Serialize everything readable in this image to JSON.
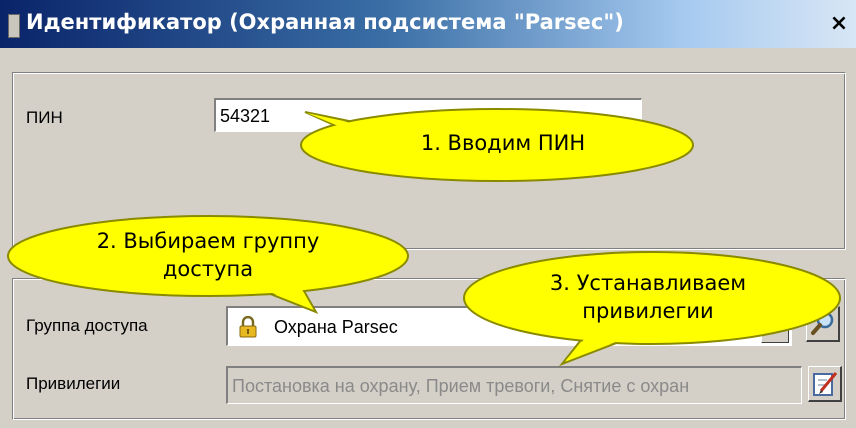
{
  "window": {
    "title": "Идентификатор (Охранная подсистема \"Parsec\")",
    "close_label": "×"
  },
  "fields": {
    "pin_label": "ПИН",
    "pin_value": "54321",
    "access_group_label": "Группа доступа",
    "access_group_value": "Охрана Parsec",
    "privileges_label": "Привилегии",
    "privileges_value": "Постановка на охрану, Прием тревоги, Снятие с охран"
  },
  "callouts": {
    "step1": "1. Вводим ПИН",
    "step2_line1": "2. Выбираем группу",
    "step2_line2": "доступа",
    "step3_line1": "3. Устанавливаем",
    "step3_line2": "привилегии"
  },
  "colors": {
    "callout_fill": "#ffff00",
    "callout_stroke": "#8a8a00",
    "window_bg": "#d4d0c8"
  },
  "icons": {
    "title": "window-icon",
    "lock": "lock-icon",
    "search": "search-icon",
    "edit": "edit-icon",
    "dropdown": "chevron-down-icon"
  }
}
